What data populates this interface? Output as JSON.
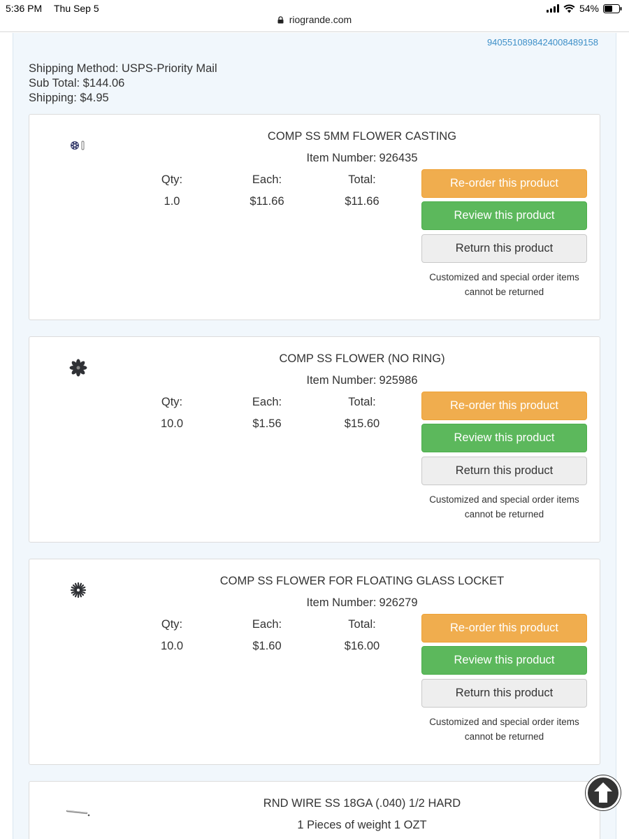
{
  "status_bar": {
    "time": "5:36 PM",
    "day": "Thu Sep 5",
    "battery": "54%"
  },
  "browser": {
    "url": "riogrande.com"
  },
  "order": {
    "tracking_number": "9405510898424008489158",
    "shipping_method_label": "Shipping Method: USPS-Priority Mail",
    "subtotal_label": "Sub Total: $144.06",
    "shipping_label": "Shipping: $4.95"
  },
  "labels": {
    "qty": "Qty:",
    "each": "Each:",
    "total": "Total:",
    "item_number": "Item Number:",
    "reorder": "Re-order this product",
    "review": "Review this product",
    "return": "Return this product",
    "return_note": "Customized and special order items cannot be returned"
  },
  "items": [
    {
      "name": "COMP SS 5MM FLOWER CASTING",
      "item_number": "926435",
      "qty": "1.0",
      "each": "$11.66",
      "total": "$11.66",
      "icon": "flower-casting-thumbnail"
    },
    {
      "name": "COMP SS FLOWER (NO RING)",
      "item_number": "925986",
      "qty": "10.0",
      "each": "$1.56",
      "total": "$15.60",
      "icon": "flower-thumbnail"
    },
    {
      "name": "COMP SS FLOWER FOR FLOATING GLASS LOCKET",
      "item_number": "926279",
      "qty": "10.0",
      "each": "$1.60",
      "total": "$16.00",
      "icon": "flower-locket-thumbnail"
    },
    {
      "name": "RND WIRE SS 18GA (.040) 1/2 HARD",
      "subtitle": "1 Pieces of weight 1 OZT",
      "icon": "wire-thumbnail"
    }
  ]
}
